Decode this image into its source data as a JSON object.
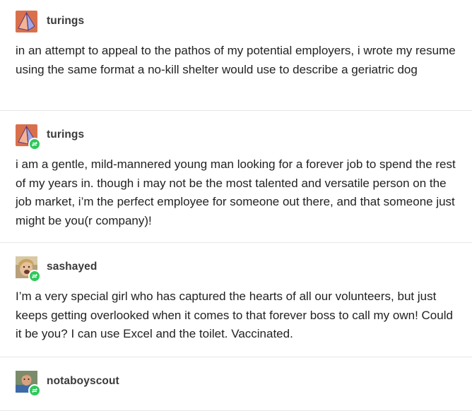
{
  "posts": [
    {
      "username": "turings",
      "avatar": "turings-pyramid-avatar",
      "reblogged": false,
      "text": "in an attempt to appeal to the pathos of my potential employers, i wrote my resume using the same format a no-kill shelter would use to describe a geriatric dog"
    },
    {
      "username": "turings",
      "avatar": "turings-pyramid-avatar",
      "reblogged": true,
      "text": "i am a gentle, mild-mannered young man looking for a forever job to spend the rest of my years in. though i may not be the most talented and versatile person on the job market, i’m the perfect employee for someone out there, and that someone just might be you(r company)!"
    },
    {
      "username": "sashayed",
      "avatar": "sashayed-photo-avatar",
      "reblogged": true,
      "text": "I’m a very special girl who has captured the hearts of all our volunteers, but just keeps getting overlooked when it comes to that forever boss to call my own! Could it be you? I can use Excel and the toilet. Vaccinated."
    },
    {
      "username": "notaboyscout",
      "avatar": "notaboyscout-photo-avatar",
      "reblogged": true,
      "text": ""
    }
  ],
  "colors": {
    "reblog_badge": "#2ec95a",
    "divider": "#e6e6e6",
    "text": "#222222"
  }
}
